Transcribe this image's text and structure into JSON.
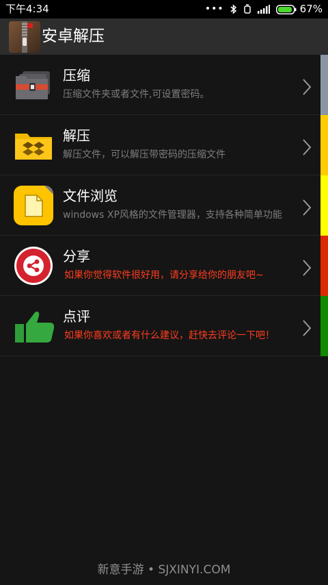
{
  "status_bar": {
    "time": "下午4:34",
    "more": "•••",
    "battery_percent": "67%",
    "icons": [
      "bluetooth-icon",
      "alarm-icon",
      "signal-icon",
      "battery-icon"
    ]
  },
  "app_bar": {
    "title": "安卓解压",
    "logo": "zip-archive-icon"
  },
  "menu": [
    {
      "title": "压缩",
      "desc": "压缩文件夹或者文件,可设置密码。",
      "icon": "folder-stack-icon",
      "accent": "#8a97a3"
    },
    {
      "title": "解压",
      "desc": "解压文件，可以解压带密码的压缩文件",
      "icon": "yellow-folder-icon",
      "accent": "#ffcc00"
    },
    {
      "title": "文件浏览",
      "desc": "windows XP风格的文件管理器，支持各种简单功能",
      "icon": "file-browser-icon",
      "accent": "#ffff00"
    },
    {
      "title": "分享",
      "desc": "如果你觉得软件很好用，请分享给你的朋友吧~",
      "icon": "share-icon",
      "accent": "#dd2a00"
    },
    {
      "title": "点评",
      "desc": "如果你喜欢或者有什么建议，赶快去评论一下吧！",
      "icon": "thumbs-up-icon",
      "accent": "#108a00"
    }
  ],
  "colors": {
    "background": "#151515",
    "app_bar": "#2d2d2d",
    "desc_gray": "#7d7d7d",
    "desc_red": "#ff3d1f"
  },
  "watermark": "新意手游 • SJXINYI.COM"
}
